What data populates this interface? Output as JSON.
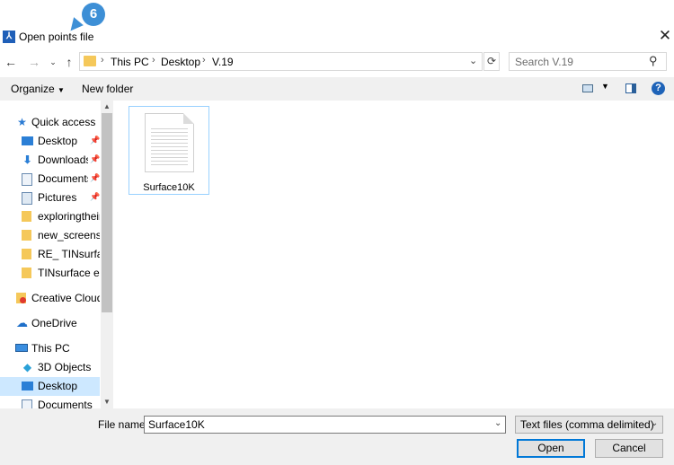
{
  "window": {
    "title": "Open points file",
    "callout_number": "6"
  },
  "nav": {
    "breadcrumb": [
      "This PC",
      "Desktop",
      "V.19"
    ],
    "search_placeholder": "Search V.19"
  },
  "toolbar": {
    "organize_label": "Organize",
    "new_folder_label": "New folder"
  },
  "sidebar": {
    "items": [
      {
        "label": "Quick access",
        "icon": "star-icon"
      },
      {
        "label": "Desktop",
        "icon": "desktop-icon",
        "pinned": true
      },
      {
        "label": "Downloads",
        "icon": "download-icon",
        "pinned": true
      },
      {
        "label": "Documents",
        "icon": "documents-icon",
        "pinned": true
      },
      {
        "label": "Pictures",
        "icon": "pictures-icon",
        "pinned": true
      },
      {
        "label": "exploringtheint",
        "icon": "folder-icon"
      },
      {
        "label": "new_screensho",
        "icon": "folder-icon"
      },
      {
        "label": "RE_ TINsurface",
        "icon": "folder-icon"
      },
      {
        "label": "TINsurface exa",
        "icon": "folder-icon"
      },
      {
        "label": "Creative Cloud F",
        "icon": "creative-cloud-icon"
      },
      {
        "label": "OneDrive",
        "icon": "cloud-icon"
      },
      {
        "label": "This PC",
        "icon": "computer-icon"
      },
      {
        "label": "3D Objects",
        "icon": "cube-icon"
      },
      {
        "label": "Desktop",
        "icon": "desktop-icon",
        "selected": true
      },
      {
        "label": "Documents",
        "icon": "documents-icon"
      }
    ]
  },
  "content": {
    "files": [
      {
        "name": "Surface10K",
        "icon": "text-file-icon"
      }
    ]
  },
  "bottom": {
    "file_name_label": "File name:",
    "file_name_value": "Surface10K",
    "file_type_value": "Text files (comma delimited)",
    "open_label": "Open",
    "cancel_label": "Cancel"
  },
  "colors": {
    "accent": "#0078d7",
    "selection": "#cde8ff",
    "callout": "#3d8fd6"
  }
}
